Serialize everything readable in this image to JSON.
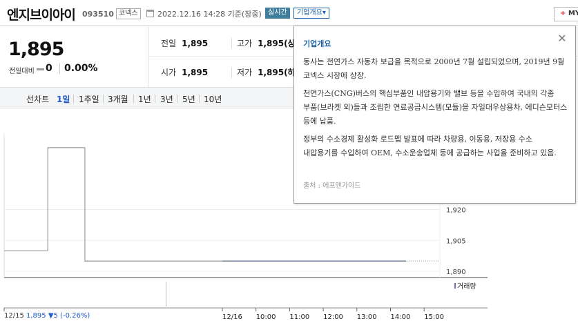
{
  "header": {
    "stock_name": "엔지브이아이",
    "stock_code": "093510",
    "market": "코넥스",
    "datetime": "2022.12.16 14:28 기준(장중)",
    "realtime_label": "실시간",
    "company_overview_label": "기업개요",
    "my_label": "MY",
    "my_icon": "plus-icon"
  },
  "price": {
    "current": "1,895",
    "change_label": "전일대비",
    "change_value": "0",
    "change_pct": "0.00%"
  },
  "stats": {
    "prev_close_label": "전일",
    "prev_close": "1,895",
    "high_label": "고가",
    "high": "1,895",
    "high_tag": "(상",
    "open_label": "시가",
    "open": "1,895",
    "low_label": "저가",
    "low": "1,895",
    "low_tag": "(하"
  },
  "tabs": {
    "label": "선차트",
    "items": [
      "1일",
      "1주일",
      "3개월",
      "1년",
      "3년",
      "5년",
      "10년"
    ],
    "active": 0
  },
  "chart_data": {
    "type": "line",
    "y_ticks": [
      "1,920",
      "1,905",
      "1,890"
    ],
    "x_ticks": [
      "12/16",
      "10:00",
      "11:00",
      "12:00",
      "13:00",
      "14:00",
      "15:00"
    ],
    "volume_label": "거래량",
    "prev_day_line": [
      {
        "t": 0.0,
        "y": 1900
      },
      {
        "t": 0.2,
        "y": 1900
      },
      {
        "t": 0.2,
        "y": 1950
      },
      {
        "t": 0.37,
        "y": 1950
      },
      {
        "t": 0.37,
        "y": 1895
      },
      {
        "t": 1.0,
        "y": 1895
      }
    ],
    "today_line": [
      {
        "time": "09:00",
        "y": 1895
      },
      {
        "time": "14:28",
        "y": 1895
      }
    ],
    "line_color": "#999999",
    "today_color": "#5a6b8c"
  },
  "prev_day": {
    "date": "12/15",
    "value": "1,895 ▼5 (-0.26%)"
  },
  "popup": {
    "title": "기업개요",
    "close_icon": "close-icon",
    "paragraphs": [
      "동사는 천연가스 자동차 보급을 목적으로 2000년 7월 설립되었으며, 2019년 9월 코넥스 시장에 상장.",
      "천연가스(CNG)버스의 핵심부품인 내압용기와 밸브 등을 수입하여 국내의 각종 부품(브라켓 외)들과 조립한 연료공급시스템(모듈)을 자일대우상용차, 에디슨모터스 등에 납품.",
      "정부의 수소경제 활성화 로드맵 발표에 따라 차량용, 이동용, 저장용 수소 내압용기를 수입하여 OEM, 수소운송업체 등에 공급하는 사업을 준비하고 있음."
    ],
    "source": "출처 : 에프앤가이드"
  }
}
